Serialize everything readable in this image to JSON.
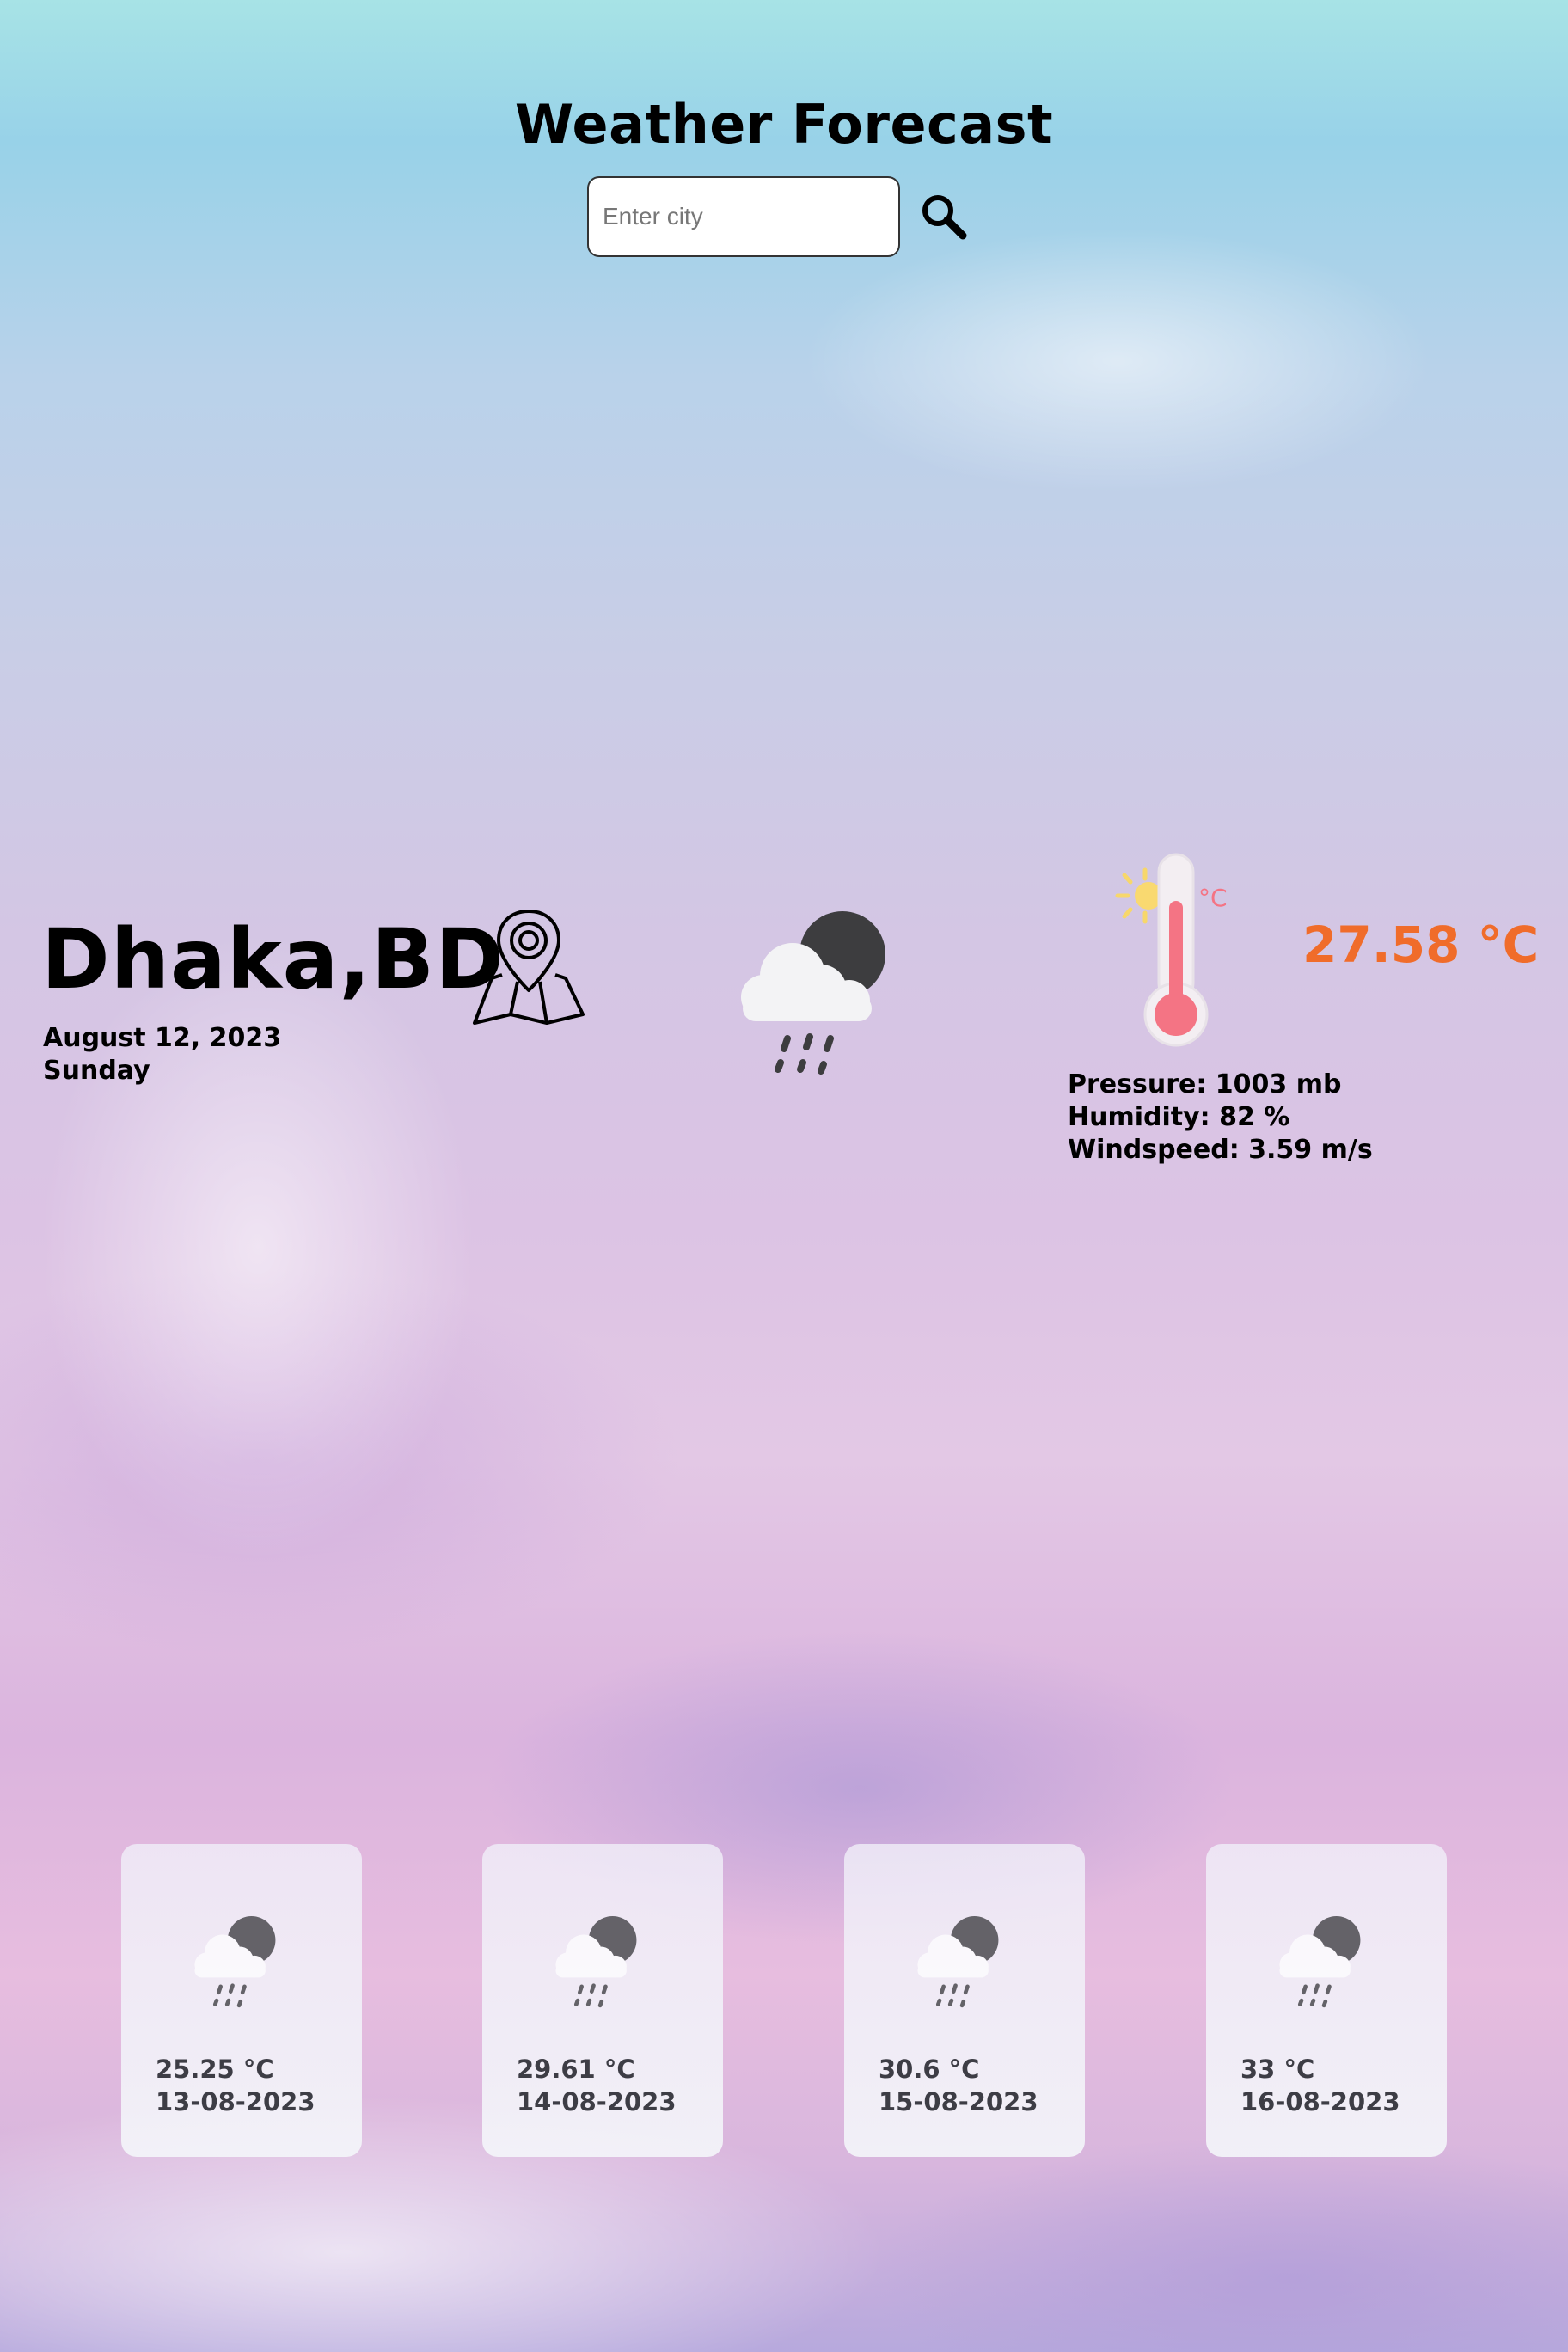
{
  "app": {
    "title": "Weather Forecast"
  },
  "search": {
    "placeholder": "Enter city",
    "value": "",
    "icon": "search-icon"
  },
  "location": {
    "city": "Dhaka,BD",
    "date": "August 12, 2023",
    "day": "Sunday",
    "icon": "map-pin-icon"
  },
  "current": {
    "condition_icon": "rain-night-cloud-icon",
    "thermometer_icon": "thermometer-sun-icon",
    "temperature": "27.58 °C",
    "temperature_color": "#f06c2a",
    "pressure": "Pressure: 1003 mb",
    "humidity": "Humidity: 82 %",
    "windspeed": "Windspeed: 3.59 m/s"
  },
  "forecast": [
    {
      "temp": "25.25 °C",
      "date": "13-08-2023",
      "icon": "rain-night-cloud-icon"
    },
    {
      "temp": "29.61 °C",
      "date": "14-08-2023",
      "icon": "rain-night-cloud-icon"
    },
    {
      "temp": "30.6 °C",
      "date": "15-08-2023",
      "icon": "rain-night-cloud-icon"
    },
    {
      "temp": "33 °C",
      "date": "16-08-2023",
      "icon": "rain-night-cloud-icon"
    }
  ]
}
